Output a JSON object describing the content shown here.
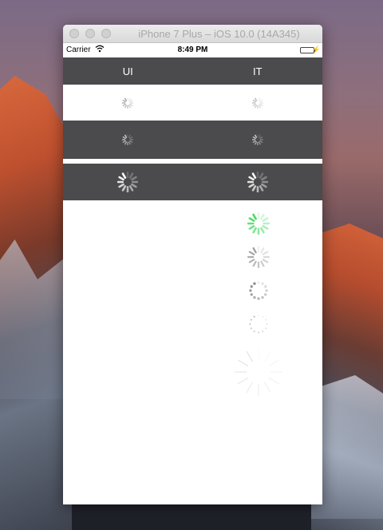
{
  "window": {
    "title": "iPhone 7 Plus – iOS 10.0 (14A345)"
  },
  "statusbar": {
    "carrier": "Carrier",
    "time": "8:49 PM",
    "battery_level": 1.0
  },
  "table": {
    "columns": [
      "UI",
      "IT"
    ]
  },
  "colors": {
    "dark_row": "#4b4a4c",
    "green_spinner": "#4cd964",
    "battery_green": "#4cd964"
  },
  "icons": {
    "spinner": "activity-indicator-icon",
    "wifi": "wifi-icon",
    "battery": "battery-icon",
    "charging": "bolt-icon"
  }
}
